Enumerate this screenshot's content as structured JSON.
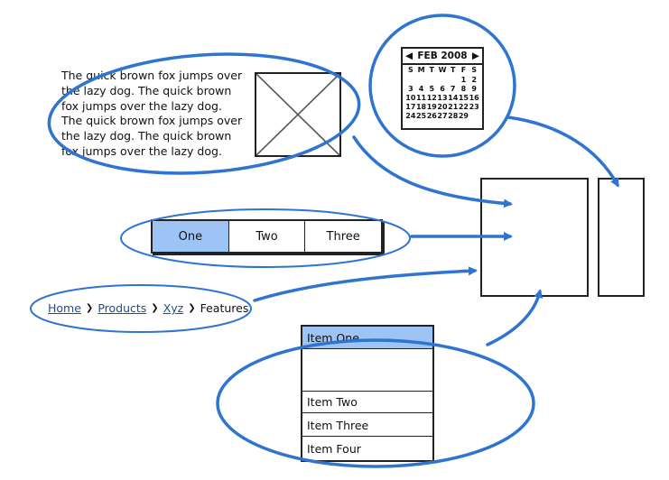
{
  "paragraph": "The quick brown fox jumps over the lazy dog. The quick brown fox jumps over the lazy dog. The quick brown fox jumps over the lazy dog. The quick brown fox jumps over the lazy dog.",
  "calendar": {
    "month_label": "FEB 2008",
    "weekdays": [
      "S",
      "M",
      "T",
      "W",
      "T",
      "F",
      "S"
    ],
    "days": [
      "",
      "",
      "",
      "",
      "",
      "1",
      "2",
      "3",
      "4",
      "5",
      "6",
      "7",
      "8",
      "9",
      "10",
      "11",
      "12",
      "13",
      "14",
      "15",
      "16",
      "17",
      "18",
      "19",
      "20",
      "21",
      "22",
      "23",
      "24",
      "25",
      "26",
      "27",
      "28",
      "29",
      ""
    ]
  },
  "tabs": [
    {
      "label": "One",
      "selected": true
    },
    {
      "label": "Two",
      "selected": false
    },
    {
      "label": "Three",
      "selected": false
    }
  ],
  "breadcrumb": {
    "links": [
      "Home",
      "Products",
      "Xyz"
    ],
    "current": "Features"
  },
  "list": {
    "items": [
      "Item One",
      "Item Two",
      "Item Three",
      "Item Four"
    ]
  },
  "colors": {
    "accent_blue": "#2f74d0",
    "selection_fill": "#9ec3f5",
    "link": "#1d4e86"
  }
}
